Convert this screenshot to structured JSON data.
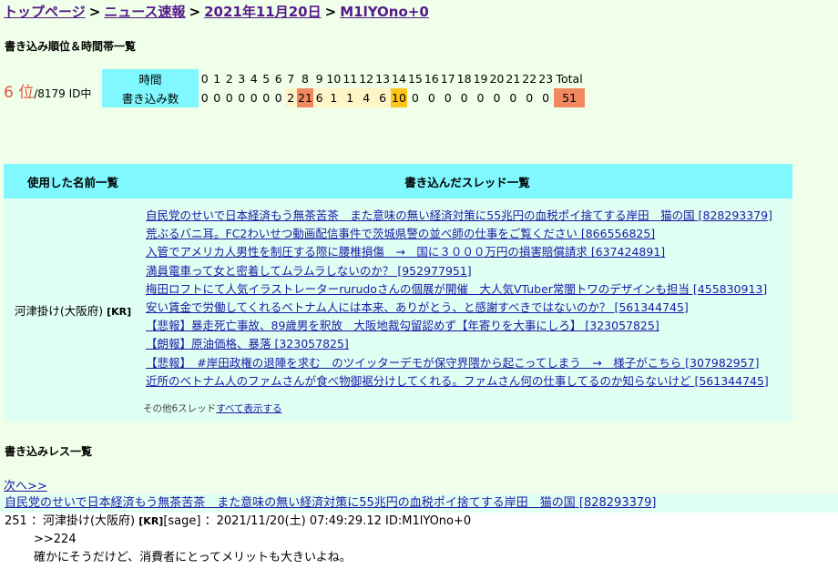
{
  "breadcrumb": {
    "top": "トップページ",
    "news": "ニュース速報",
    "date": "2021年11月20日",
    "id": "M1lYOno+0",
    "separator": ">"
  },
  "ranking_section": {
    "title": "書き込み順位＆時間帯一覧",
    "rank": "6 位",
    "total_ids": "/8179 ID中",
    "time_label": "時間",
    "count_label": "書き込み数",
    "hours": [
      "0",
      "1",
      "2",
      "3",
      "4",
      "5",
      "6",
      "7",
      "8",
      "9",
      "10",
      "11",
      "12",
      "13",
      "14",
      "15",
      "16",
      "17",
      "18",
      "19",
      "20",
      "21",
      "22",
      "23",
      "Total"
    ],
    "counts": [
      "0",
      "0",
      "0",
      "0",
      "0",
      "0",
      "0",
      "2",
      "21",
      "6",
      "1",
      "1",
      "4",
      "6",
      "10",
      "0",
      "0",
      "0",
      "0",
      "0",
      "0",
      "0",
      "0",
      "0",
      "51"
    ],
    "colors": {
      "low": "#fff3c8",
      "max": "#f08860",
      "high": "#ffc61a",
      "header": "#80f8ff"
    }
  },
  "threads_table": {
    "names_header": "使用した名前一覧",
    "threads_header": "書き込んだスレッド一覧",
    "name": "河津掛け(大阪府)",
    "name_tag": "[KR]",
    "threads": [
      "自民党のせいで日本経済もう無茶苦茶　また意味の無い経済対策に55兆円の血税ポイ捨てする岸田　猫の国 [828293379]",
      "荒ぶるバニ耳。FC2わいせつ動画配信事件で茨城県警の並べ師の仕事をご覧ください [866556825]",
      "入管でアメリカ人男性を制圧する際に腰椎損傷　→　国に３０００万円の損害賠償請求 [637424891]",
      "満員電車って女と密着してムラムラしないのか？ [952977951]",
      "梅田ロフトにて人気イラストレーターrurudoさんの個展が開催　大人気VTuber常闇トワのデザインも担当 [455830913]",
      "安い賃金で労働してくれるベトナム人には本来、ありがとう、と感謝すべきではないのか？ [561344745]",
      "【悲報】暴走死亡事故、89歳男を釈放　大阪地裁勾留認めず【年寄りを大事にしろ】 [323057825]",
      "【朗報】原油価格、暴落 [323057825]",
      "【悲報】　#岸田政権の退陣を求む　のツイッターデモが保守界隈から起こってしまう　→　様子がこちら [307982957]",
      "近所のベトナム人のファムさんが食べ物御裾分けしてくれる。ファムさん何の仕事してるのか知らないけど [561344745]"
    ],
    "others_prefix": "その他6スレッド",
    "others_link": "すべて表示する"
  },
  "responses_section": {
    "title": "書き込みレス一覧",
    "next": "次へ>>",
    "thread_title": "自民党のせいで日本経済もう無茶苦茶　また意味の無い経済対策に55兆円の血税ポイ捨てする岸田　猫の国 [828293379]",
    "res_number": "251",
    "res_name": "河津掛け(大阪府)",
    "res_tag": "[KR]",
    "res_sage": "[sage]",
    "res_datetime": "2021/11/20(土) 07:49:29.12",
    "res_id": "ID:M1lYOno+0",
    "res_anchor": ">>224",
    "res_body": "確かにそうだけど、消費者にとってメリットも大きいよね。"
  }
}
